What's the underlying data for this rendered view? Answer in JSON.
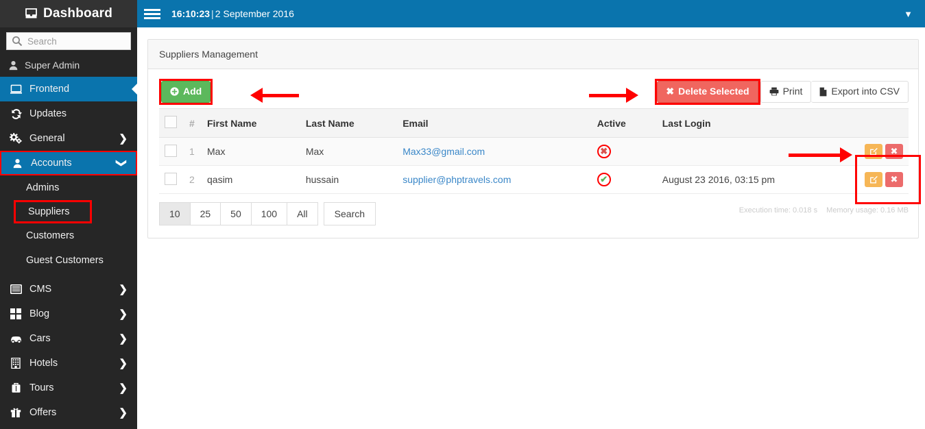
{
  "sidebar": {
    "brand": "Dashboard",
    "brand_icon": "dashboard-inbox-icon",
    "search": {
      "placeholder": "Search",
      "value": "",
      "icon": "search-icon"
    },
    "user": {
      "name": "Super Admin",
      "icon": "user-icon"
    },
    "items": [
      {
        "label": "Frontend",
        "icon": "monitor-icon",
        "state": "active",
        "caret": ""
      },
      {
        "label": "Updates",
        "icon": "refresh-icon",
        "state": "normal",
        "caret": ""
      },
      {
        "label": "General",
        "icon": "gears-icon",
        "state": "normal",
        "caret": "❯"
      },
      {
        "label": "Accounts",
        "icon": "user-icon",
        "state": "active-highlighted",
        "caret": "❯"
      },
      {
        "label": "CMS",
        "icon": "window-icon",
        "state": "normal",
        "caret": "❯"
      },
      {
        "label": "Blog",
        "icon": "grid-icon",
        "state": "normal",
        "caret": "❯"
      },
      {
        "label": "Cars",
        "icon": "car-icon",
        "state": "normal",
        "caret": "❯"
      },
      {
        "label": "Hotels",
        "icon": "building-icon",
        "state": "normal",
        "caret": "❯"
      },
      {
        "label": "Tours",
        "icon": "suitcase-icon",
        "state": "normal",
        "caret": "❯"
      },
      {
        "label": "Offers",
        "icon": "gift-icon",
        "state": "normal",
        "caret": "❯"
      }
    ],
    "submenu": [
      {
        "label": "Admins",
        "highlighted": false
      },
      {
        "label": "Suppliers",
        "highlighted": true
      },
      {
        "label": "Customers",
        "highlighted": false
      },
      {
        "label": "Guest Customers",
        "highlighted": false
      }
    ]
  },
  "topbar": {
    "menu_icon": "hamburger-icon",
    "time": "16:10:23",
    "separator": "|",
    "date": "2 September 2016",
    "caret_icon": "chevron-down-icon"
  },
  "panel": {
    "title": "Suppliers Management"
  },
  "toolbar": {
    "add_label": "Add",
    "add_icon": "plus-circle-icon",
    "delete_label": "Delete Selected",
    "delete_icon": "times-icon",
    "print_label": "Print",
    "print_icon": "printer-icon",
    "export_label": "Export into CSV",
    "export_icon": "file-icon"
  },
  "table": {
    "columns": [
      "",
      "#",
      "First Name",
      "Last Name",
      "Email",
      "Active",
      "Last Login",
      ""
    ],
    "rows": [
      {
        "num": "1",
        "first_name": "Max",
        "last_name": "Max",
        "email": "Max33@gmail.com",
        "active": "inactive",
        "active_glyph": "✖",
        "last_login": "",
        "edit_icon": "edit-icon",
        "delete_icon": "times-icon"
      },
      {
        "num": "2",
        "first_name": "qasim",
        "last_name": "hussain",
        "email": "supplier@phptravels.com",
        "active": "active",
        "active_glyph": "✔",
        "last_login": "August 23 2016, 03:15 pm",
        "edit_icon": "edit-icon",
        "delete_icon": "times-icon"
      }
    ]
  },
  "footer": {
    "page_sizes": [
      "10",
      "25",
      "50",
      "100",
      "All"
    ],
    "selected_page_size": "10",
    "search_label": "Search",
    "execution_time": "Execution time: 0.018 s",
    "memory_usage": "Memory usage: 0.16 MB"
  },
  "annotations": {
    "arrow_add": "arrow-pointing-left-at-add-button",
    "arrow_delete": "arrow-pointing-right-at-delete-button",
    "arrow_actions": "arrow-pointing-right-at-row-actions"
  },
  "colors": {
    "accent": "#0a74ad",
    "sidebar": "#262626",
    "success": "#5cb85c",
    "danger": "#f0665f",
    "highlight": "#ff0000",
    "edit": "#f6b656"
  }
}
